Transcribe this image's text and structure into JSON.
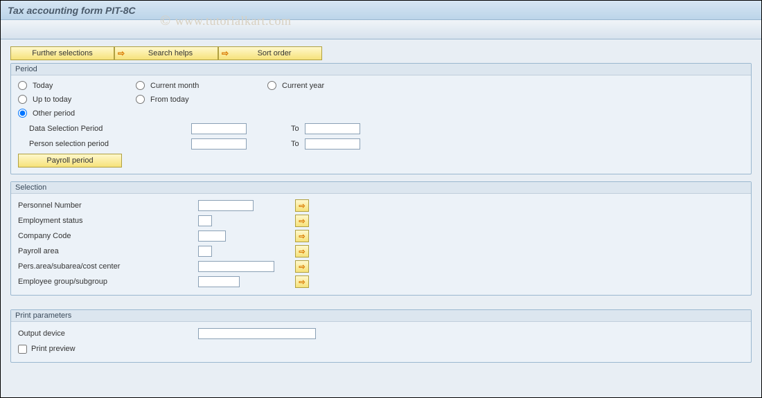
{
  "title": "Tax accounting form PIT-8C",
  "watermark": "www.tutorialkart.com",
  "toolbar": {
    "further_selections": "Further selections",
    "search_helps": "Search helps",
    "sort_order": "Sort order"
  },
  "period": {
    "group_label": "Period",
    "today": "Today",
    "current_month": "Current month",
    "current_year": "Current year",
    "up_to_today": "Up to today",
    "from_today": "From today",
    "other_period": "Other period",
    "data_selection_period": "Data Selection Period",
    "person_selection_period": "Person selection period",
    "to_label": "To",
    "payroll_period_btn": "Payroll period",
    "data_from": "",
    "data_to": "",
    "person_from": "",
    "person_to": ""
  },
  "selection": {
    "group_label": "Selection",
    "personnel_number": "Personnel Number",
    "employment_status": "Employment status",
    "company_code": "Company Code",
    "payroll_area": "Payroll area",
    "pers_area": "Pers.area/subarea/cost center",
    "employee_group": "Employee group/subgroup",
    "v_personnel": "",
    "v_emp": "",
    "v_cc": "",
    "v_pa": "",
    "v_area": "",
    "v_eg": ""
  },
  "print": {
    "group_label": "Print parameters",
    "output_device": "Output device",
    "print_preview": "Print preview",
    "v_output": ""
  }
}
